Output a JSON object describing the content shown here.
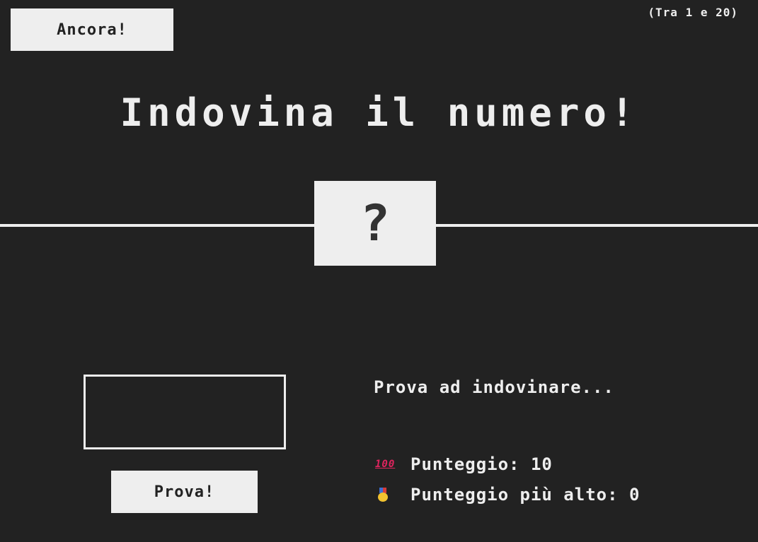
{
  "header": {
    "again_label": "Ancora!",
    "between_text": "(Tra 1 e 20)"
  },
  "main": {
    "title": "Indovina il numero!",
    "secret_number": "?"
  },
  "left": {
    "guess_value": "",
    "check_label": "Prova!"
  },
  "right": {
    "message": "Prova ad indovinare...",
    "score_icon": "hundred-points-icon",
    "score_label": "Punteggio:",
    "score_value": "10",
    "highscore_icon": "medal-icon",
    "highscore_label": "Punteggio più alto:",
    "highscore_value": "0"
  },
  "colors": {
    "background": "#222222",
    "foreground": "#eeeeee"
  }
}
